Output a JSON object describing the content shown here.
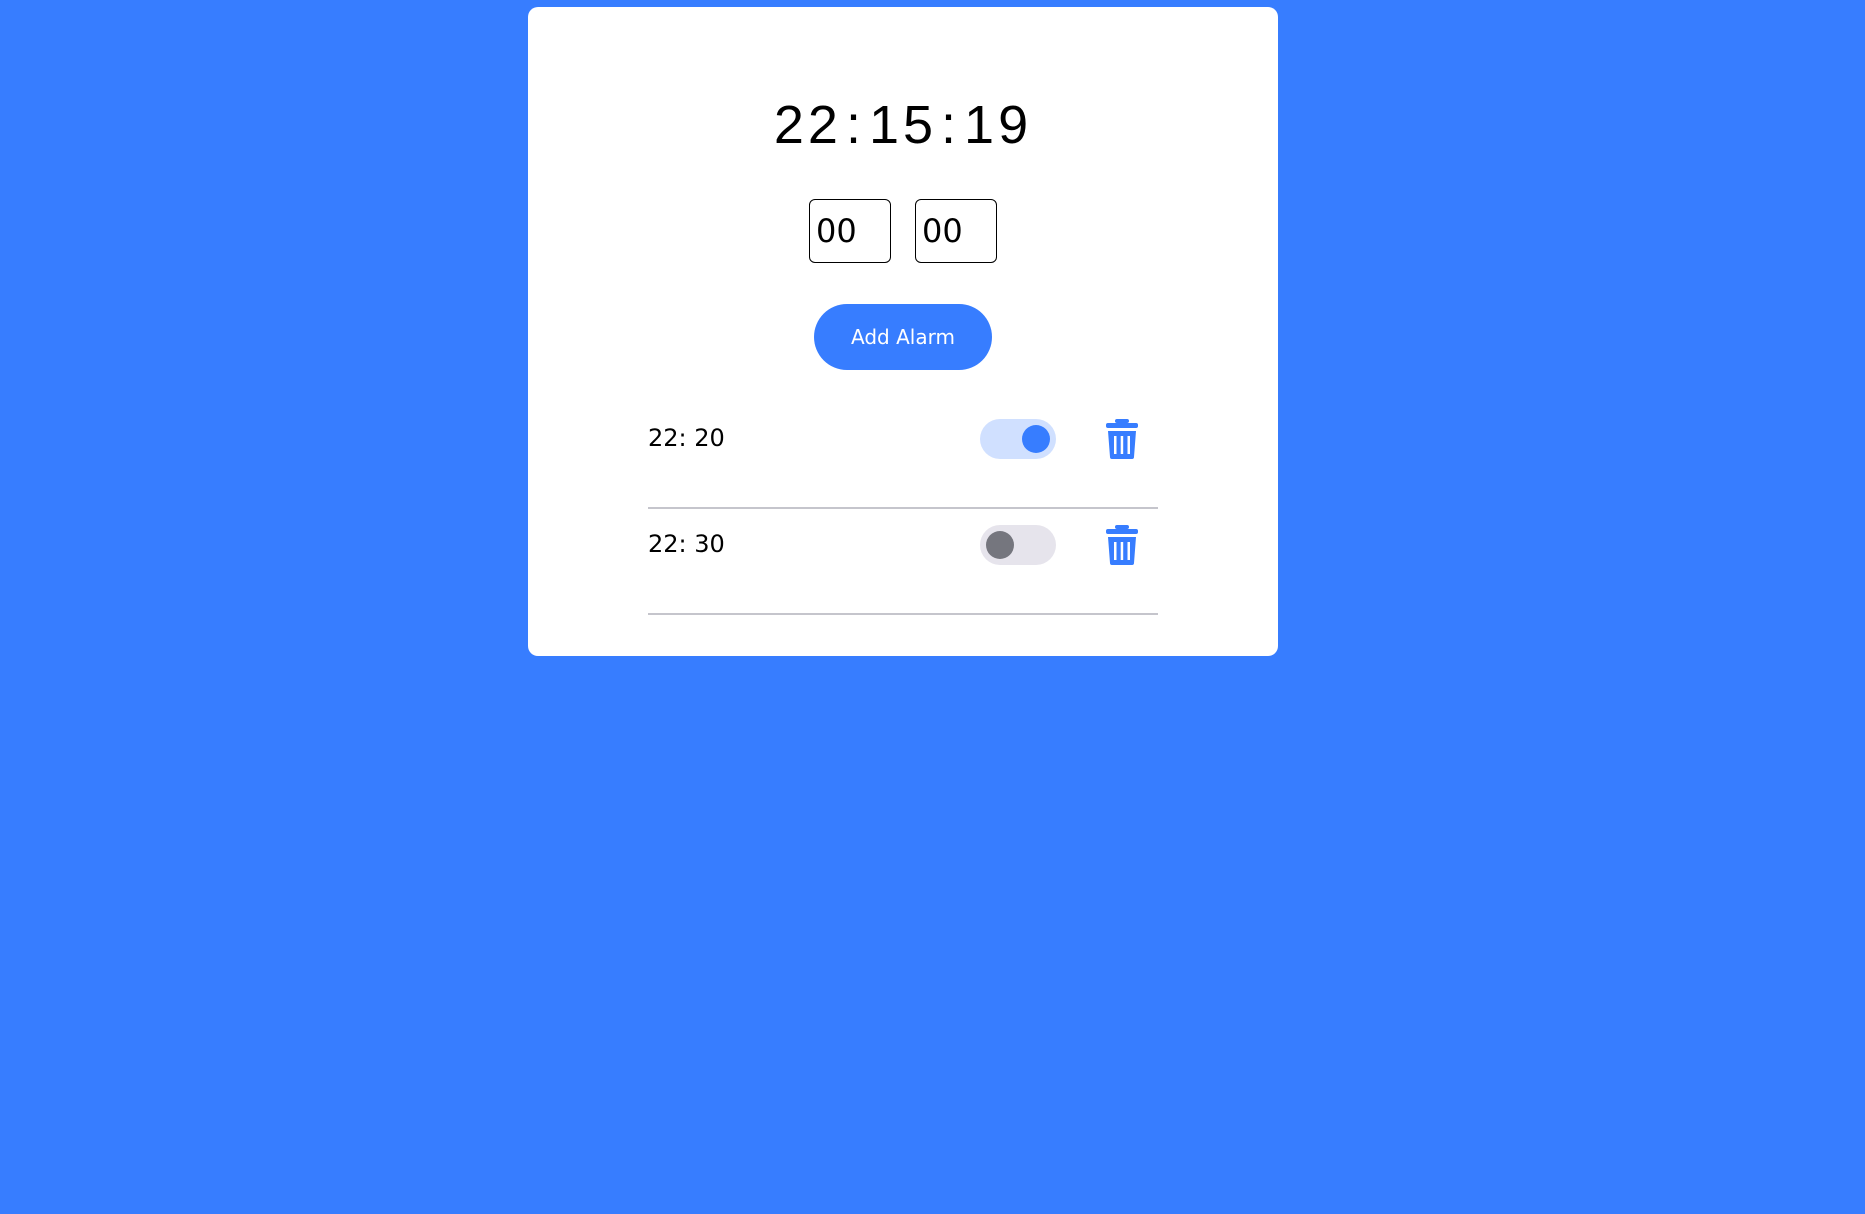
{
  "clock": {
    "hours": "22",
    "minutes": "15",
    "seconds": "19",
    "separator": ":"
  },
  "inputs": {
    "hour_value": "00",
    "minute_value": "00"
  },
  "add_button": {
    "label": "Add Alarm"
  },
  "alarms": [
    {
      "time": "22: 20",
      "enabled": true
    },
    {
      "time": "22: 30",
      "enabled": false
    }
  ],
  "icons": {
    "delete": "trash-icon"
  },
  "colors": {
    "background": "#377dff",
    "accent": "#377dff",
    "card": "#ffffff",
    "toggle_on_track": "#d0e0ff",
    "toggle_off_track": "#e6e4ec",
    "toggle_off_knob": "#75767e"
  }
}
